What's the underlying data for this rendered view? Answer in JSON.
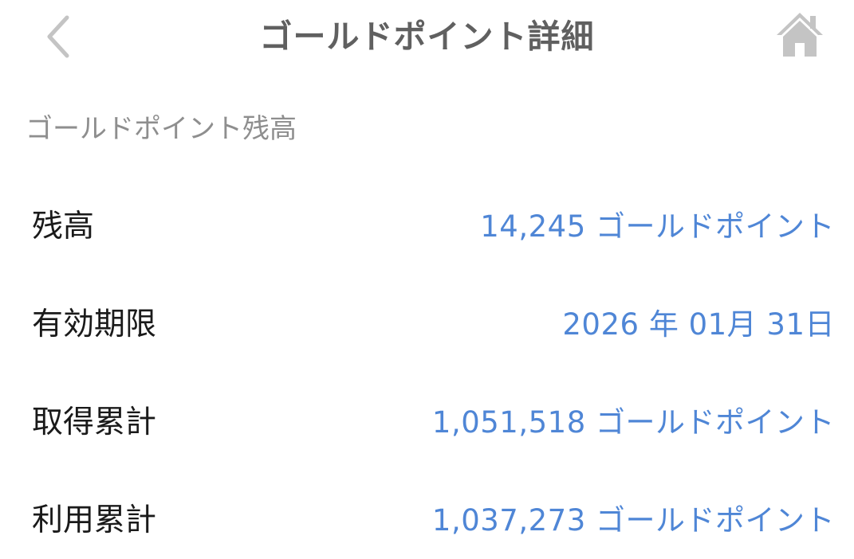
{
  "nav": {
    "title": "ゴールドポイント詳細",
    "back_icon": "chevron-left-icon",
    "home_icon": "home-icon",
    "icon_color": "#c4c4c4"
  },
  "section": {
    "header": "ゴールドポイント残高"
  },
  "rows": [
    {
      "label": "残高",
      "value": "14,245 ゴールドポイント"
    },
    {
      "label": "有効期限",
      "value": "2026 年 01月 31日"
    },
    {
      "label": "取得累計",
      "value": "1,051,518 ゴールドポイント"
    },
    {
      "label": "利用累計",
      "value": "1,037,273 ゴールドポイント"
    }
  ],
  "colors": {
    "value_text": "#4f86d6",
    "label_text": "#1a1a1a",
    "section_header": "#8e8e8e",
    "title_text": "#606060"
  }
}
